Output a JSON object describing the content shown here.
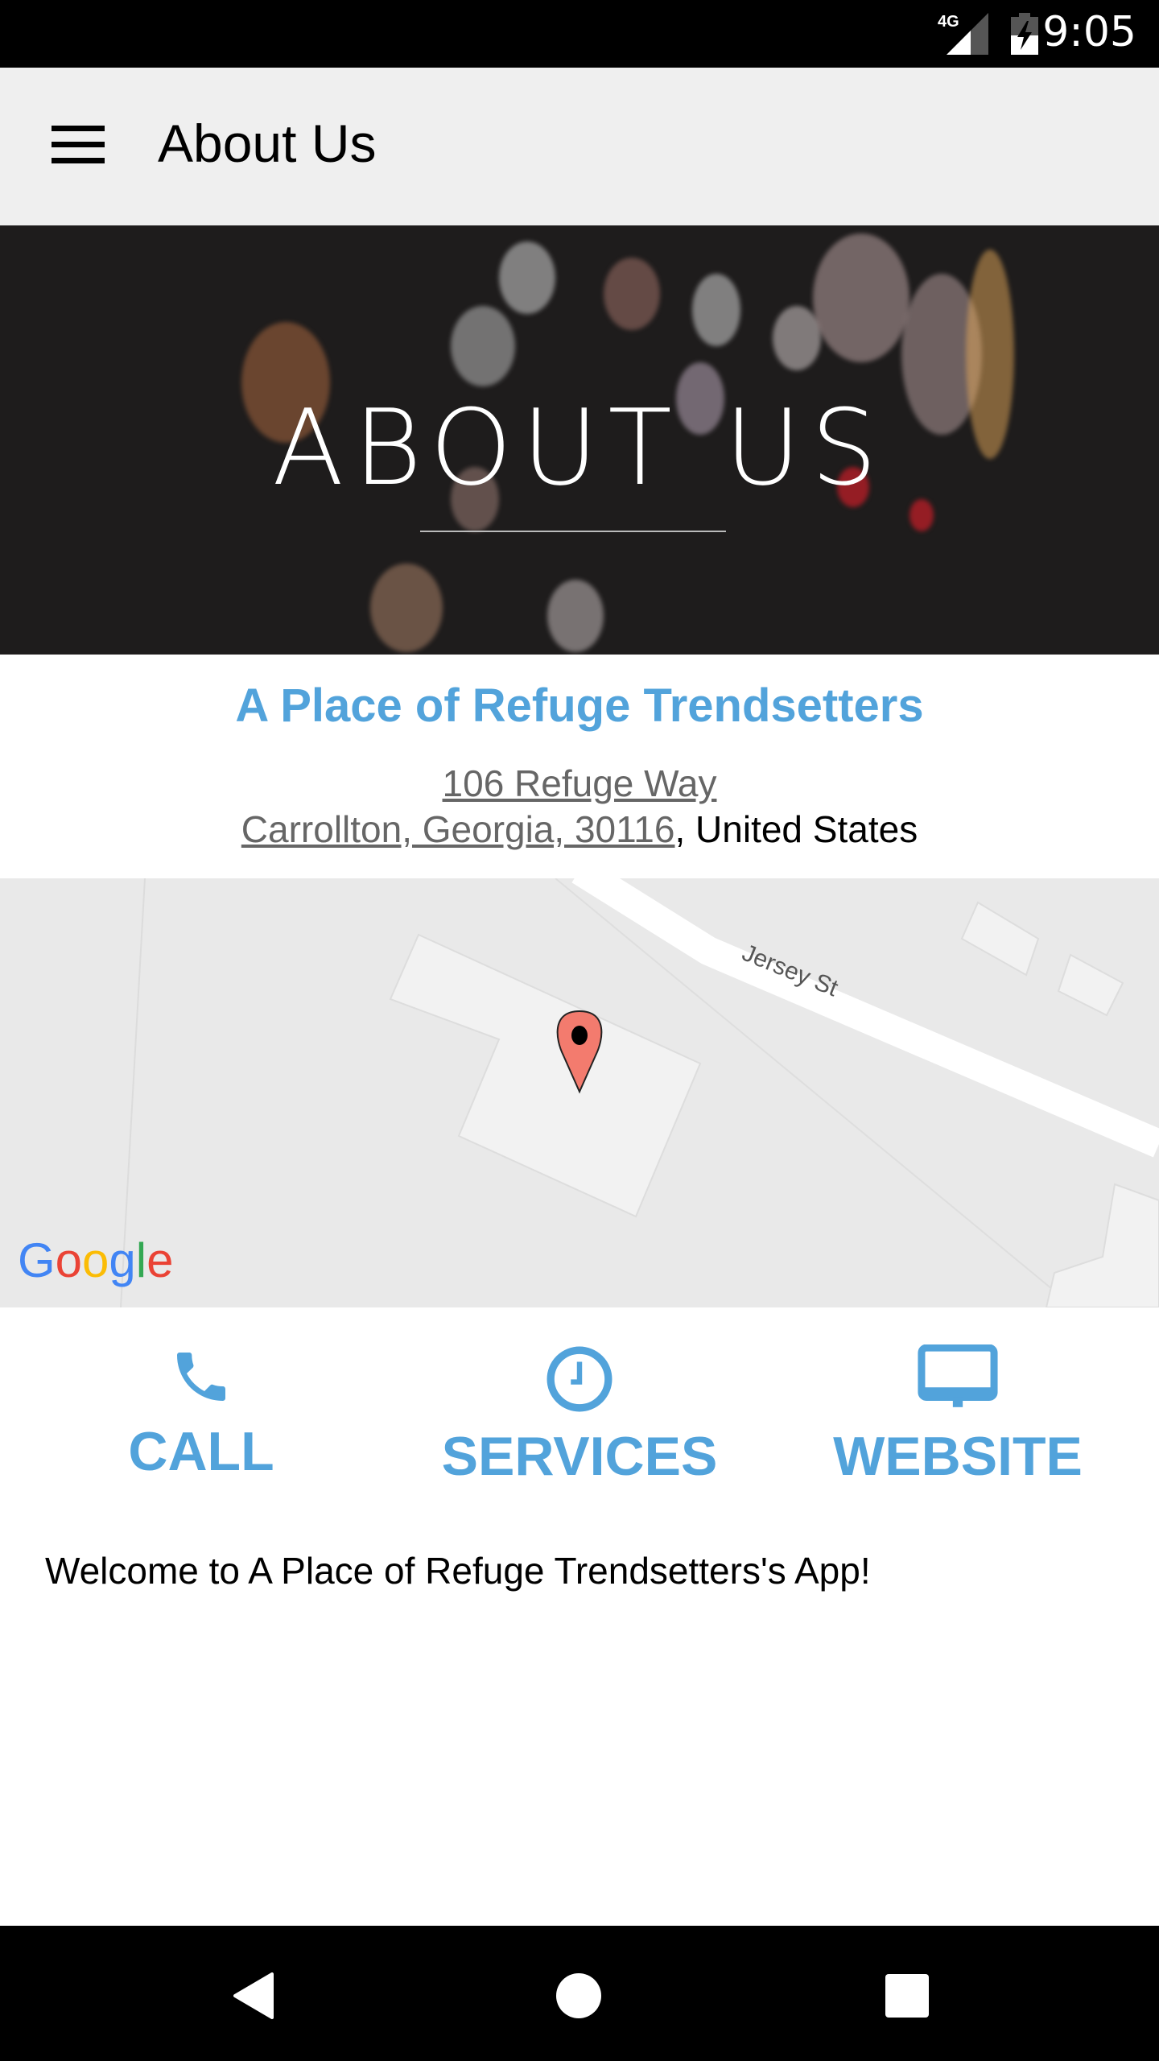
{
  "status_bar": {
    "network": "4G",
    "time": "9:05"
  },
  "app_bar": {
    "title": "About Us",
    "menu_icon": "hamburger-menu-icon"
  },
  "hero": {
    "title": "ABOUT US"
  },
  "business": {
    "name": "A Place of Refuge Trendsetters",
    "address_line1": "106 Refuge Way",
    "address_line2_link": "Carrollton, Georgia, 30116",
    "address_line2_country": ", United States"
  },
  "map": {
    "street_label": "Jersey St",
    "logo": "Google",
    "marker": "map-pin-icon"
  },
  "actions": [
    {
      "label": "CALL",
      "icon": "phone-icon"
    },
    {
      "label": "SERVICES",
      "icon": "clock-icon"
    },
    {
      "label": "WEBSITE",
      "icon": "monitor-icon"
    }
  ],
  "welcome_text": "Welcome to A Place of Refuge Trendsetters's App!",
  "colors": {
    "accent": "#52a3db",
    "app_bar": "#efefef",
    "link_gray": "#666666",
    "map_bg": "#e9e9e9",
    "pin": "#f37b6e"
  }
}
